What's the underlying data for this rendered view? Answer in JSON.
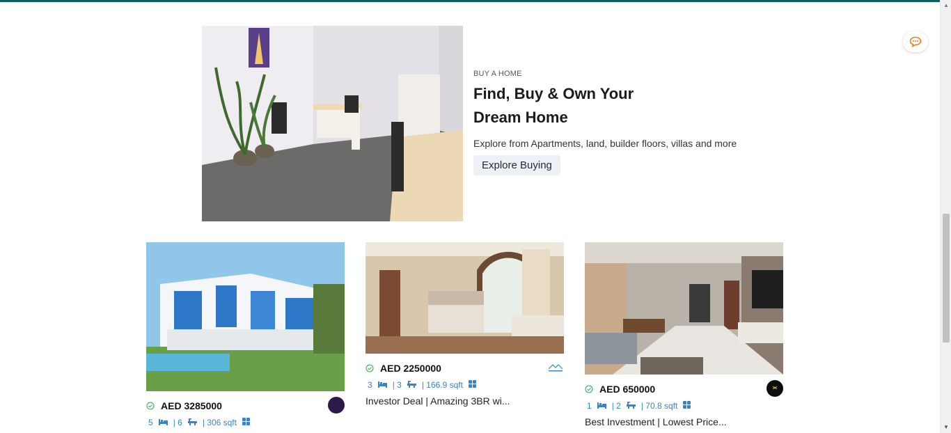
{
  "hero": {
    "eyebrow": "BUY A HOME",
    "headline": "Find, Buy & Own Your Dream Home",
    "subtext": "Explore from Apartments, land, builder floors, villas and more",
    "cta_label": "Explore Buying"
  },
  "listings": [
    {
      "price": "AED 3285000",
      "beds": "5",
      "baths": "| 6",
      "area": "| 306 sqft",
      "title": ""
    },
    {
      "price": "AED 2250000",
      "beds": "3",
      "baths": "| 3",
      "area": "| 166.9 sqft",
      "title": "Investor Deal | Amazing 3BR wi..."
    },
    {
      "price": "AED 650000",
      "beds": "1",
      "baths": "| 2",
      "area": "| 70.8 sqft",
      "title": "Best Investment | Lowest Price..."
    }
  ],
  "colors": {
    "accent_blue": "#3b82c4",
    "top_bar": "#0f5f5c",
    "chat_icon": "#f07a1a",
    "verified_green": "#2fa84f"
  },
  "icons": {
    "chat": "chat-bubble-icon",
    "verified": "check-circle-icon",
    "bed": "bed-icon",
    "bath": "bathtub-icon",
    "area": "grid-icon"
  }
}
